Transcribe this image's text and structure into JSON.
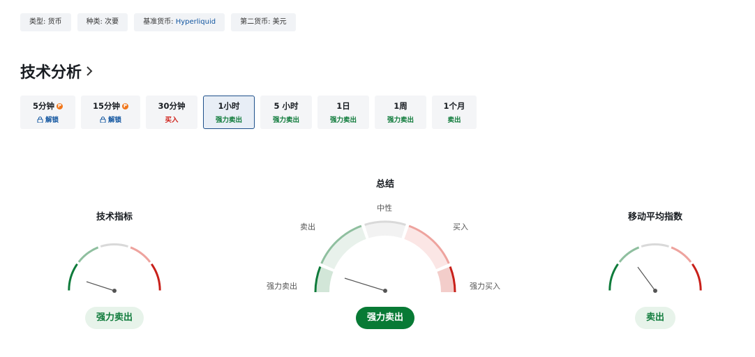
{
  "tags": [
    {
      "label": "类型:",
      "value": "货币"
    },
    {
      "label": "种类:",
      "value": "次要"
    },
    {
      "label": "基准货币:",
      "value": "Hyperliquid"
    },
    {
      "label": "第二货币:",
      "value": "美元"
    }
  ],
  "section": {
    "title": "技术分析"
  },
  "tabs": [
    {
      "label": "5分钟",
      "status": "解锁"
    },
    {
      "label": "15分钟",
      "status": "解锁"
    },
    {
      "label": "30分钟",
      "status": "买入"
    },
    {
      "label": "1小时",
      "status": "强力卖出"
    },
    {
      "label": "5 小时",
      "status": "强力卖出"
    },
    {
      "label": "1日",
      "status": "强力卖出"
    },
    {
      "label": "1周",
      "status": "强力卖出"
    },
    {
      "label": "1个月",
      "status": "卖出"
    }
  ],
  "gauges": {
    "indicators": {
      "title": "技术指标",
      "result": "强力卖出"
    },
    "summary": {
      "title": "总结",
      "result": "强力卖出",
      "labels": {
        "strong_sell": "强力卖出",
        "sell": "卖出",
        "neutral": "中性",
        "buy": "买入",
        "strong_buy": "强力买入"
      }
    },
    "moving_averages": {
      "title": "移动平均指数",
      "result": "卖出"
    }
  },
  "colors": {
    "strong_sell": "#0f7b3b",
    "sell": "#8fbf9f",
    "neutral": "#d9d9d9",
    "buy": "#eea39e",
    "strong_buy": "#c8201a",
    "active_border": "#1d4f8a"
  }
}
